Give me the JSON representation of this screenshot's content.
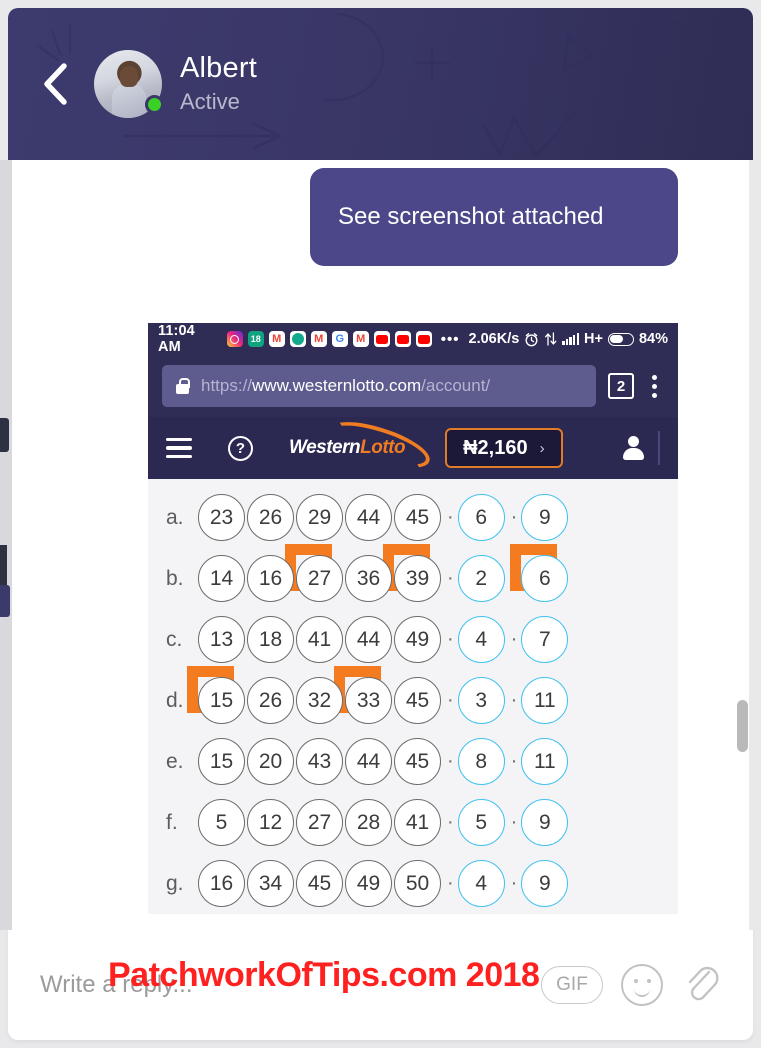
{
  "header": {
    "back_icon": "chevron-left-icon",
    "contact_name": "Albert",
    "contact_status": "Active",
    "status_dot_color": "#39d124",
    "background_color": "#3d3a6e"
  },
  "conversation": {
    "message": {
      "text": "See screenshot attached",
      "bubble_color": "#4b4789",
      "align": "right"
    }
  },
  "attachment": {
    "status_bar": {
      "time": "11:04 AM",
      "app_icons": [
        "instagram-icon",
        "calendar-icon-18",
        "gmail-icon",
        "whatsapp-icon",
        "gmail-icon",
        "google-icon",
        "gmail-icon",
        "youtube-icon",
        "youtube-icon",
        "youtube-icon"
      ],
      "calendar_day": "18",
      "gmail_glyph": "M",
      "google_glyph": "G",
      "more_icon": "•••",
      "network_speed": "2.06K/s",
      "alarm_icon": "alarm-clock-icon",
      "data_transfer_icon": "data-transfer-icon",
      "signal_icon": "signal-bars-icon",
      "network_type": "H+",
      "battery_icon": "battery-icon",
      "battery_percent": "84%"
    },
    "browser_bar": {
      "lock_icon": "lock-icon",
      "url_scheme": "https://",
      "url_domain": "www.westernlotto.com",
      "url_path": "/account/",
      "tab_count": "2",
      "menu_icon": "three-dot-menu-icon"
    },
    "site_toolbar": {
      "menu_icon": "hamburger-menu-icon",
      "help_label": "?",
      "logo_part1": "Western",
      "logo_part2": "Lotto",
      "balance": "₦2,160",
      "balance_chevron": "›",
      "account_icon": "user-account-icon",
      "accent_color": "#f07c22",
      "background_color": "#2b2852"
    },
    "lotto": {
      "highlight_color": "#f47b20",
      "bonus_ball_color": "#3ec0f0",
      "separator": "·",
      "rows": [
        {
          "label": "a.",
          "main": [
            "23",
            "26",
            "29",
            "44",
            "45"
          ],
          "bonus": [
            "6",
            "9"
          ],
          "highlighted": []
        },
        {
          "label": "b.",
          "main": [
            "14",
            "16",
            "27",
            "36",
            "39"
          ],
          "bonus": [
            "2",
            "6"
          ],
          "highlighted": [
            "27",
            "39",
            "6"
          ]
        },
        {
          "label": "c.",
          "main": [
            "13",
            "18",
            "41",
            "44",
            "49"
          ],
          "bonus": [
            "4",
            "7"
          ],
          "highlighted": []
        },
        {
          "label": "d.",
          "main": [
            "15",
            "26",
            "32",
            "33",
            "45"
          ],
          "bonus": [
            "3",
            "11"
          ],
          "highlighted": [
            "15",
            "33"
          ]
        },
        {
          "label": "e.",
          "main": [
            "15",
            "20",
            "43",
            "44",
            "45"
          ],
          "bonus": [
            "8",
            "11"
          ],
          "highlighted": []
        },
        {
          "label": "f.",
          "main": [
            "5",
            "12",
            "27",
            "28",
            "41"
          ],
          "bonus": [
            "5",
            "9"
          ],
          "highlighted": []
        },
        {
          "label": "g.",
          "main": [
            "16",
            "34",
            "45",
            "49",
            "50"
          ],
          "bonus": [
            "4",
            "9"
          ],
          "highlighted": []
        }
      ]
    }
  },
  "reply_bar": {
    "placeholder": "Write a reply...",
    "gif_label": "GIF",
    "emoji_icon": "smiley-face-icon",
    "attach_icon": "paperclip-icon"
  },
  "watermark": {
    "text": "PatchworkOfTips.com 2018",
    "color": "#ff2020"
  }
}
